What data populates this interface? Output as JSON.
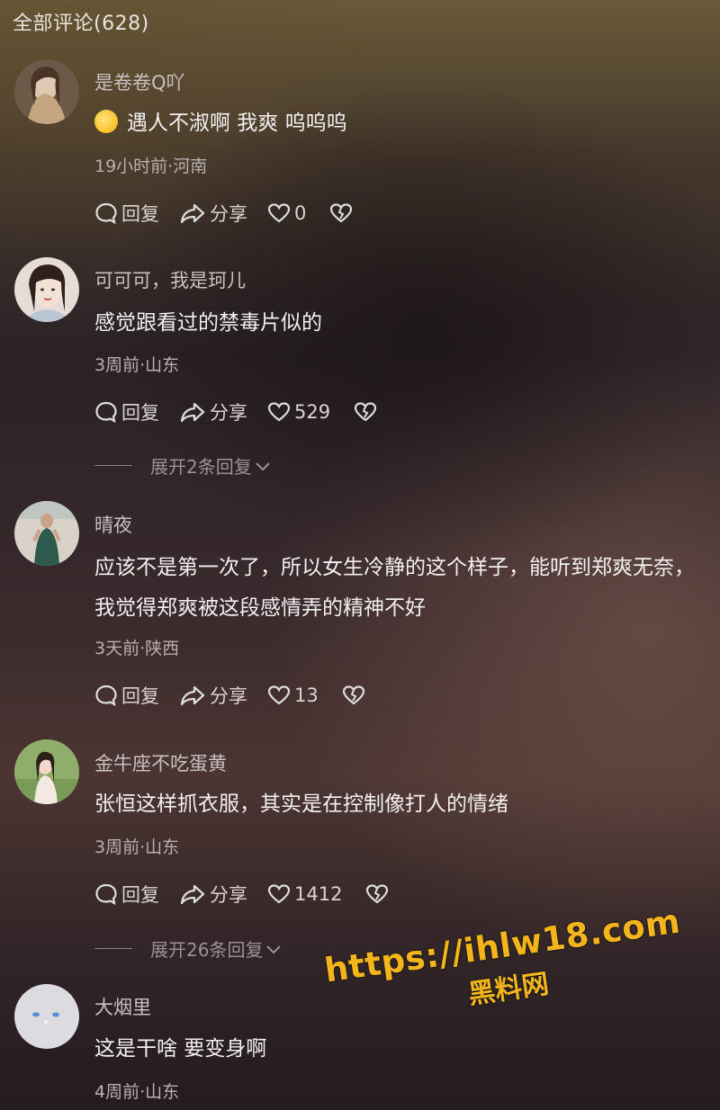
{
  "header": {
    "title": "全部评论(628)"
  },
  "comments": [
    {
      "username": "是卷卷Q吖",
      "text": "遇人不淑啊 我爽 呜呜呜",
      "has_emoji": true,
      "meta": "19小时前·河南",
      "reply_label": "回复",
      "share_label": "分享",
      "likes": "0",
      "avatar_colors": [
        "#d9c4a8",
        "#8a6a4a"
      ]
    },
    {
      "username": "可可可，我是珂儿",
      "text": "感觉跟看过的禁毒片似的",
      "meta": "3周前·山东",
      "reply_label": "回复",
      "share_label": "分享",
      "likes": "529",
      "expand_label": "展开2条回复",
      "avatar_colors": [
        "#f1dfd6",
        "#3a2a26"
      ]
    },
    {
      "username": "晴夜",
      "text": "应该不是第一次了，所以女生冷静的这个样子，能听到郑爽无奈，我觉得郑爽被这段感情弄的精神不好",
      "meta": "3天前·陕西",
      "reply_label": "回复",
      "share_label": "分享",
      "likes": "13",
      "avatar_colors": [
        "#d9d2c8",
        "#2f5a4a"
      ]
    },
    {
      "username": "金牛座不吃蛋黄",
      "text": "张恒这样抓衣服，其实是在控制像打人的情绪",
      "meta": "3周前·山东",
      "reply_label": "回复",
      "share_label": "分享",
      "likes": "1412",
      "expand_label": "展开26条回复",
      "avatar_colors": [
        "#9fc07a",
        "#3a4a2a"
      ]
    },
    {
      "username": "大烟里",
      "text": "这是干啥 要变身啊",
      "meta": "4周前·山东",
      "avatar_colors": [
        "#d6d6da",
        "#c0c0c6"
      ]
    }
  ],
  "watermark": {
    "url": "https://ihlw18.com",
    "site": "黑料网"
  },
  "colors": {
    "accent_watermark": "#f3b41c",
    "text_primary": "#f3f0ef",
    "text_secondary": "#b8b0ae"
  }
}
